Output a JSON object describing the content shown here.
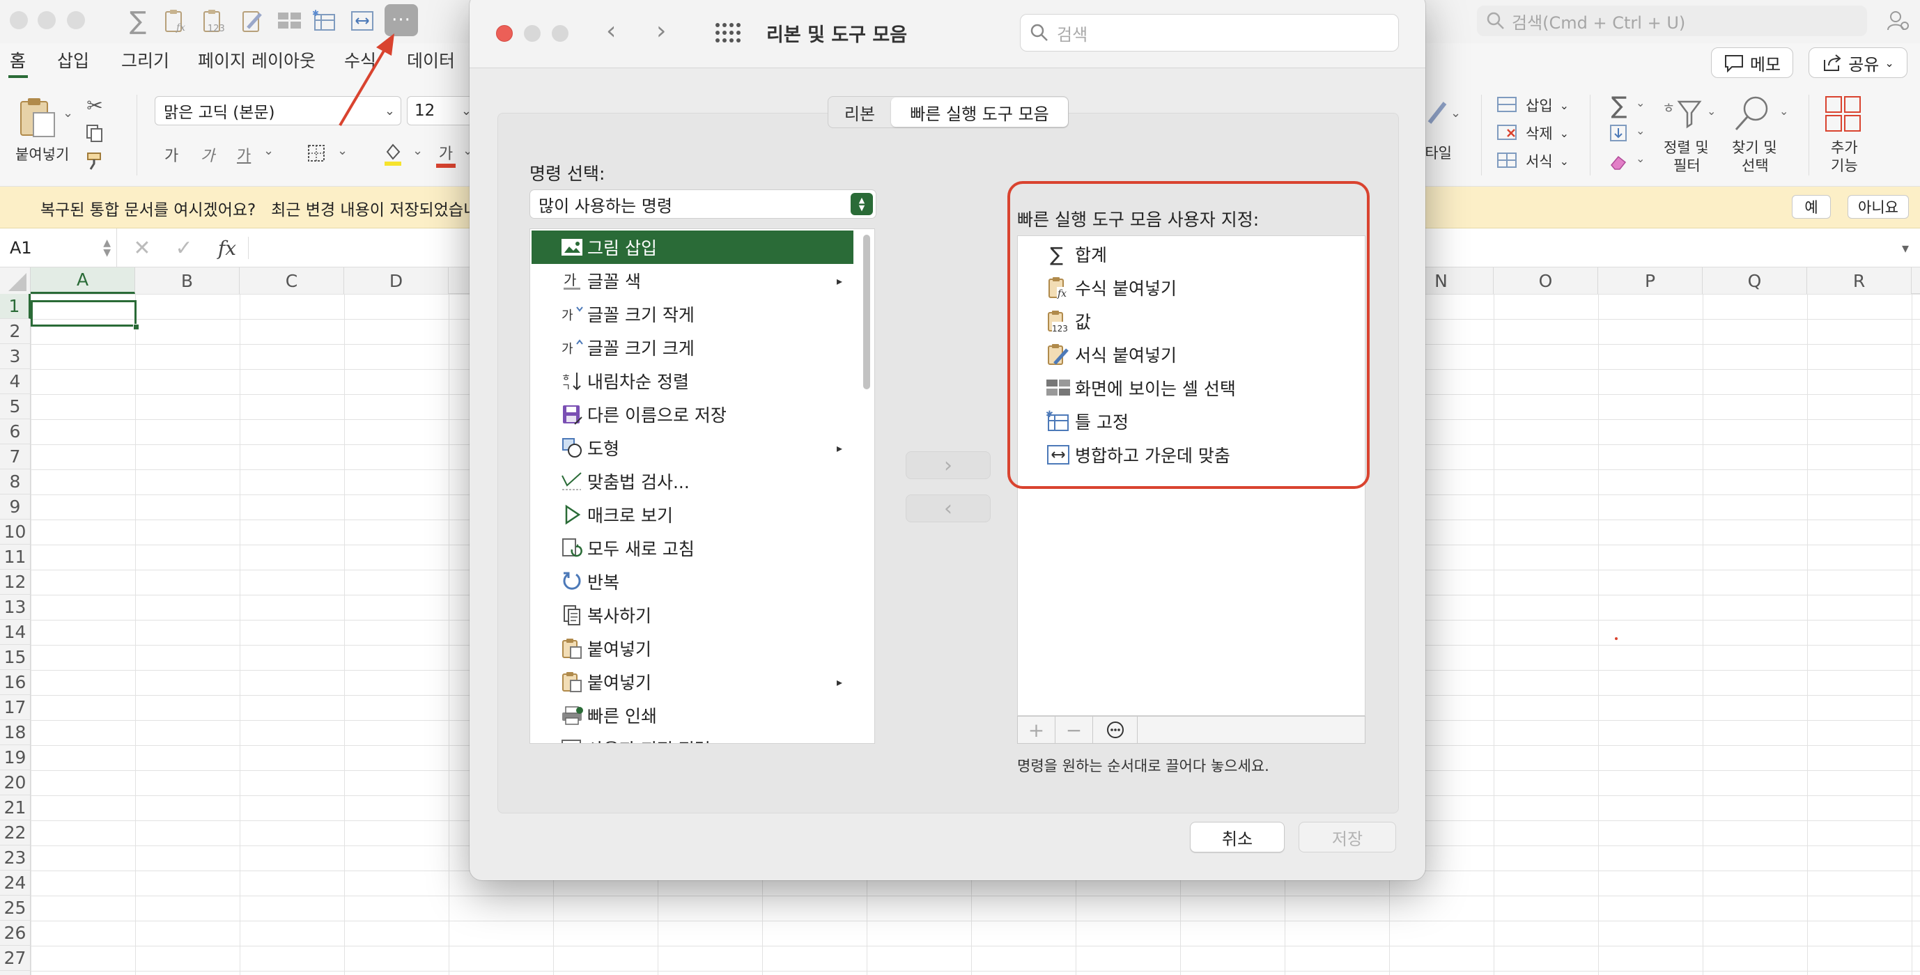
{
  "search_placeholder": "검색(Cmd + Ctrl + U)",
  "ribbon_tabs": [
    "홈",
    "삽입",
    "그리기",
    "페이지 레이아웃",
    "수식",
    "데이터"
  ],
  "memo_label": "메모",
  "share_label": "공유",
  "font_name": "맑은 고딕 (본문)",
  "font_size": "12",
  "paste_label": "붙여넣기",
  "style_label": "스타일",
  "cells_group": {
    "insert": "삽입",
    "delete": "삭제",
    "format": "서식"
  },
  "sort_filter": [
    "정렬 및",
    "필터"
  ],
  "find_select": [
    "찾기 및",
    "선택"
  ],
  "addins": [
    "추가",
    "기능"
  ],
  "font_style_glyphs": [
    "가",
    "가",
    "가"
  ],
  "font_color_glyph": "가",
  "notification": {
    "text": "복구된 통합 문서를 여시겠어요?   최근 변경 내용이 저장되었습니다",
    "yes": "예",
    "no": "아니요"
  },
  "name_box": "A1",
  "fx_label": "fx",
  "columns_left": [
    "A",
    "B",
    "C",
    "D"
  ],
  "columns_right": [
    "N",
    "O",
    "P",
    "Q",
    "R"
  ],
  "rows": [
    "1",
    "2",
    "3",
    "4",
    "5",
    "6",
    "7",
    "8",
    "9",
    "10",
    "11",
    "12",
    "13",
    "14",
    "15",
    "16",
    "17",
    "18",
    "19",
    "20",
    "21",
    "22",
    "23",
    "24",
    "25",
    "26",
    "27"
  ],
  "dialog": {
    "title": "리본 및 도구 모음",
    "search_placeholder": "검색",
    "tabs": [
      "리본",
      "빠른 실행 도구 모음"
    ],
    "choose_label": "명령 선택:",
    "choose_value": "많이 사용하는 명령",
    "commands": [
      "그림 삽입",
      "글꼴 색",
      "글꼴 크기 작게",
      "글꼴 크기 크게",
      "내림차순 정렬",
      "다른 이름으로 저장",
      "도형",
      "맞춤법 검사...",
      "매크로 보기",
      "모두 새로 고침",
      "반복",
      "복사하기",
      "붙여넣기",
      "붙여넣기",
      "빠른 인쇄",
      "사용자 지정 정렬"
    ],
    "customize_label": "빠른 실행 도구 모음 사용자 지정:",
    "qat_items": [
      "합계",
      "수식 붙여넣기",
      "값",
      "서식 붙여넣기",
      "화면에 보이는 셀 선택",
      "틀 고정",
      "병합하고 가운데 맞춤"
    ],
    "hint": "명령을 원하는 순서대로 끌어다 놓으세요.",
    "cancel": "취소",
    "save": "저장"
  },
  "colors": {
    "accent_green": "#2a6b37",
    "highlight_red": "#d9432f",
    "notif_bg": "#fcefc7"
  }
}
